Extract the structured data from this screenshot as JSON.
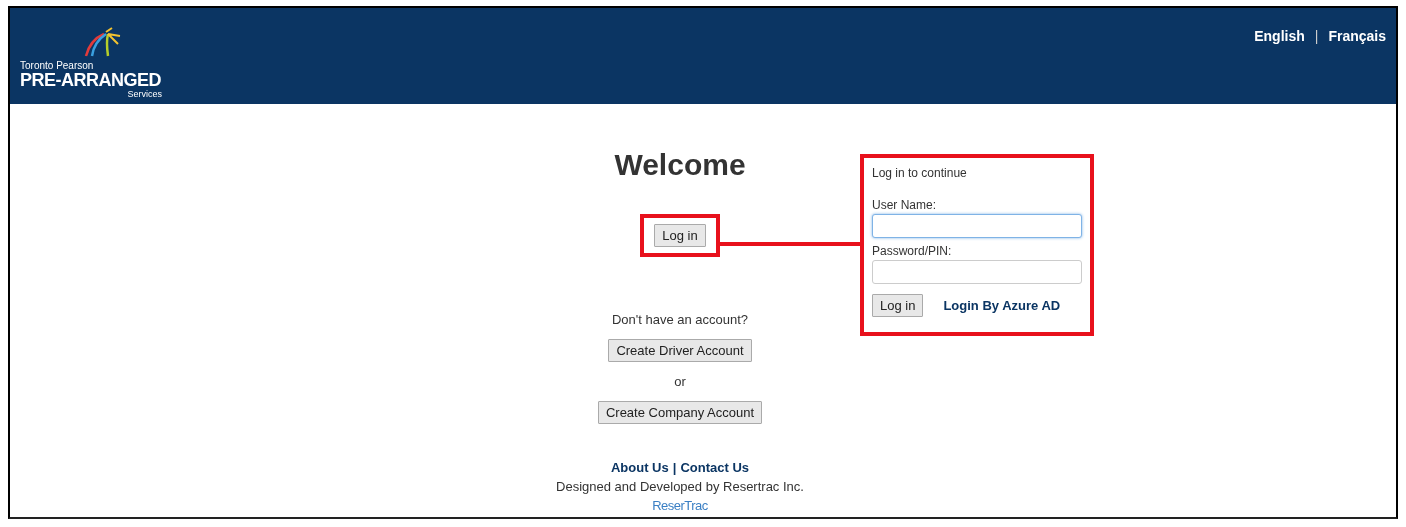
{
  "header": {
    "logo": {
      "line1": "Toronto Pearson",
      "line2": "PRE-ARRANGED",
      "line3": "Services"
    },
    "languages": [
      {
        "label": "English"
      },
      {
        "label": "Français"
      }
    ],
    "separator": "|"
  },
  "main": {
    "title": "Welcome",
    "login_button": "Log in",
    "prompt": "Don't have an account?",
    "driver_button": "Create Driver Account",
    "or": "or",
    "company_button": "Create Company Account",
    "footer_links": [
      {
        "label": "About Us"
      },
      {
        "label": "Contact Us"
      }
    ],
    "footer_separator": "|",
    "credit": "Designed and Developed by Resertrac Inc.",
    "brand": "ReserTrac"
  },
  "login_panel": {
    "title": "Log in to continue",
    "fields": [
      {
        "label": "User Name:",
        "focused": true
      },
      {
        "label": "Password/PIN:",
        "focused": false
      }
    ],
    "submit": "Log in",
    "azure_link": "Login By Azure AD"
  }
}
